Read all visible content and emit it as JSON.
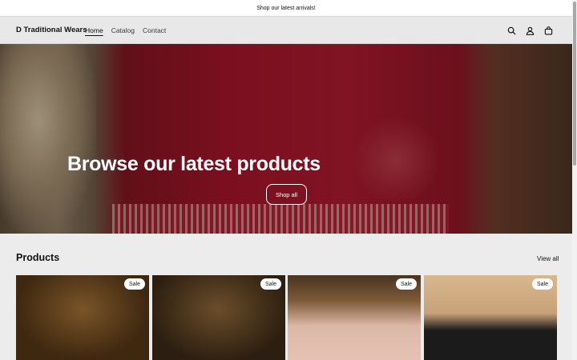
{
  "announcement": {
    "text": "Shop our latest arrivals!"
  },
  "header": {
    "logo": "D Traditional Wears",
    "nav": [
      {
        "label": "Home",
        "active": true
      },
      {
        "label": "Catalog",
        "active": false
      },
      {
        "label": "Contact",
        "active": false
      }
    ],
    "icons": [
      "search-icon",
      "account-icon",
      "cart-icon"
    ]
  },
  "hero": {
    "title": "Browse our latest products",
    "button": "Shop all"
  },
  "products": {
    "title": "Products",
    "view_all": "View all",
    "cards": [
      {
        "badge": "Sale"
      },
      {
        "badge": "Sale"
      },
      {
        "badge": "Sale"
      },
      {
        "badge": "Sale"
      }
    ]
  }
}
